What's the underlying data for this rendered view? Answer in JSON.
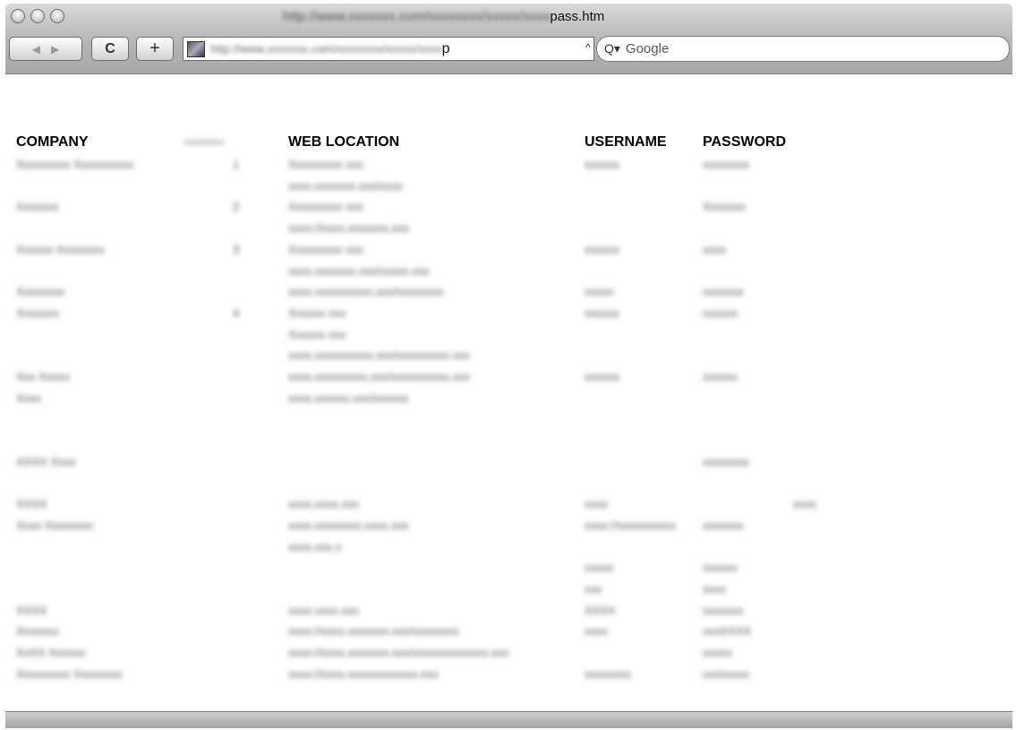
{
  "window": {
    "title_blurred": "http://www.xxxxxxx.com/xxxxxxxx/xxxxx/xxxx",
    "title_visible": "pass.htm"
  },
  "toolbar": {
    "back_glyph": "◀",
    "forward_glyph": "▶",
    "reload_glyph": "C",
    "add_glyph": "+",
    "url_blurred": "http://www.xxxxxxx.com/xxxxxxxx/xxxxx/xxxx",
    "url_tail": "p",
    "url_dropdown_glyph": "^",
    "search_glyph": "Q▾",
    "search_placeholder": "Google"
  },
  "table": {
    "headers": {
      "company": "COMPANY",
      "blurred_header": "xxxxxxxx",
      "web_location": "WEB LOCATION",
      "username": "USERNAME",
      "password": "PASSWORD"
    },
    "cells": [
      {
        "text": "Xxxxxxxxx Xxxxxxxxxx",
        "col": "c1",
        "row": 0
      },
      {
        "text": "1",
        "col": "c2",
        "row": 0
      },
      {
        "text": "Xxxxxxxxx xxx",
        "col": "c3",
        "row": 0
      },
      {
        "text": "xxxxxx",
        "col": "c4",
        "row": 0
      },
      {
        "text": "xxxxxxxx",
        "col": "c5",
        "row": 0
      },
      {
        "text": "xxxx.xxxxxxx.xxx/xxxx",
        "col": "c3",
        "row": 1
      },
      {
        "text": "Xxxxxxx",
        "col": "c1",
        "row": 2
      },
      {
        "text": "2",
        "col": "c2",
        "row": 2
      },
      {
        "text": "Xxxxxxxxx xxx",
        "col": "c3",
        "row": 2
      },
      {
        "text": "Xxxxxxx",
        "col": "c5",
        "row": 2
      },
      {
        "text": "xxxx://xxxx.xxxxxxx.xxx",
        "col": "c3",
        "row": 3
      },
      {
        "text": "Xxxxxx Xxxxxxxx",
        "col": "c1",
        "row": 4
      },
      {
        "text": "3",
        "col": "c2",
        "row": 4
      },
      {
        "text": "Xxxxxxxxx xxx",
        "col": "c3",
        "row": 4
      },
      {
        "text": "xxxxxx",
        "col": "c4",
        "row": 4
      },
      {
        "text": "xxxx",
        "col": "c5",
        "row": 4
      },
      {
        "text": "xxxx.xxxxxxx.xxx/xxxxx.xxx",
        "col": "c3",
        "row": 5
      },
      {
        "text": "Xxxxxxxx",
        "col": "c1",
        "row": 6
      },
      {
        "text": "xxxx.xxxxxxxxxx.xxx/xxxxxxxx",
        "col": "c3",
        "row": 6
      },
      {
        "text": "xxxxx",
        "col": "c4",
        "row": 6
      },
      {
        "text": "xxxxxxx",
        "col": "c5",
        "row": 6
      },
      {
        "text": "Xxxxxxx",
        "col": "c1",
        "row": 7
      },
      {
        "text": "4",
        "col": "c2",
        "row": 7
      },
      {
        "text": "Xxxxxx xxx",
        "col": "c3",
        "row": 7
      },
      {
        "text": "xxxxxx",
        "col": "c4",
        "row": 7
      },
      {
        "text": "xxxxxx",
        "col": "c5",
        "row": 7
      },
      {
        "text": "Xxxxxx xxx",
        "col": "c3",
        "row": 8
      },
      {
        "text": "xxxx.xxxxxxxxxx.xxx/xxxxxxxxx.xxx",
        "col": "c3",
        "row": 9
      },
      {
        "text": "Xxx Xxxxx",
        "col": "c1",
        "row": 10
      },
      {
        "text": "xxxx.xxxxxxxxx.xxx/xxxxxxxxxx.xxx",
        "col": "c3",
        "row": 10
      },
      {
        "text": "xxxxxx",
        "col": "c4",
        "row": 10
      },
      {
        "text": "xxxxxx",
        "col": "c5",
        "row": 10
      },
      {
        "text": "Xxxx",
        "col": "c1",
        "row": 11
      },
      {
        "text": "xxxx.xxxxxx.xxx/xxxxxx",
        "col": "c3",
        "row": 11
      },
      {
        "text": "XXXX Xxxx",
        "col": "c1",
        "row": 14
      },
      {
        "text": "xxxxxxxx",
        "col": "c5",
        "row": 14
      },
      {
        "text": "XXXX",
        "col": "c1",
        "row": 16
      },
      {
        "text": "xxxx.xxxx.xxx",
        "col": "c3",
        "row": 16
      },
      {
        "text": "xxxx",
        "col": "c4",
        "row": 16
      },
      {
        "text": "xxxx",
        "col": "c6",
        "row": 16
      },
      {
        "text": "Xxxx Xxxxxxxx",
        "col": "c1",
        "row": 17
      },
      {
        "text": "xxxx.xxxxxxxx.xxxx.xxx",
        "col": "c3",
        "row": 17
      },
      {
        "text": "xxxx://xxxxxxxxxx",
        "col": "c4",
        "row": 17
      },
      {
        "text": "xxxxxxx",
        "col": "c5",
        "row": 17
      },
      {
        "text": "xxxx.xxx.x",
        "col": "c3",
        "row": 18
      },
      {
        "text": "xxxxx",
        "col": "c4",
        "row": 19
      },
      {
        "text": "xxxxxx",
        "col": "c5",
        "row": 19
      },
      {
        "text": "xxx",
        "col": "c4",
        "row": 20
      },
      {
        "text": "xxxx",
        "col": "c5",
        "row": 20
      },
      {
        "text": "XXXX",
        "col": "c1",
        "row": 21
      },
      {
        "text": "xxxx.xxxx.xxx",
        "col": "c3",
        "row": 21
      },
      {
        "text": "XXXX",
        "col": "c4",
        "row": 21
      },
      {
        "text": "xxxxxxx",
        "col": "c5",
        "row": 21
      },
      {
        "text": "Xxxxxxx",
        "col": "c1",
        "row": 22
      },
      {
        "text": "xxxx://xxxx.xxxxxxx.xxx/xxxxxxxx",
        "col": "c3",
        "row": 22
      },
      {
        "text": "xxxx",
        "col": "c4",
        "row": 22
      },
      {
        "text": "xxxXXXX",
        "col": "c5",
        "row": 22
      },
      {
        "text": "XxXX Xxxxxx",
        "col": "c1",
        "row": 23
      },
      {
        "text": "xxxx://xxxx.xxxxxxx.xxx/xxxxxxxxxxxxx.xxx",
        "col": "c3",
        "row": 23
      },
      {
        "text": "xxxxx",
        "col": "c5",
        "row": 23
      },
      {
        "text": "Xxxxxxxxx Xxxxxxxx",
        "col": "c1",
        "row": 24
      },
      {
        "text": "xxxx://xxxx.xxxxxxxxxxxx.xxx",
        "col": "c3",
        "row": 24
      },
      {
        "text": "xxxxxxxx",
        "col": "c4",
        "row": 24
      },
      {
        "text": "xxxxxxxx",
        "col": "c5",
        "row": 24
      }
    ]
  }
}
